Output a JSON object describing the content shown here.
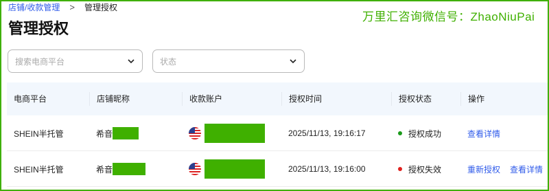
{
  "breadcrumb": {
    "parent": "店铺/收款管理",
    "separator": ">",
    "current": "管理授权"
  },
  "watermark": "万里汇咨询微信号：ZhaoNiuPai",
  "page_title": "管理授权",
  "filters": {
    "platform": {
      "placeholder": "搜索电商平台",
      "icon": "chevron-down-icon"
    },
    "status": {
      "placeholder": "状态",
      "icon": "chevron-down-icon"
    }
  },
  "table": {
    "headers": [
      "电商平台",
      "店铺昵称",
      "收款账户",
      "授权时间",
      "授权状态",
      "操作"
    ],
    "rows": [
      {
        "platform": "SHEIN半托管",
        "store_prefix": "希音",
        "account_flag": "us-flag-icon",
        "time": "2025/11/13, 19:16:17",
        "status": "授权成功",
        "status_color": "#1a9a1a",
        "actions": [
          "查看详情"
        ]
      },
      {
        "platform": "SHEIN半托管",
        "store_prefix": "希音",
        "account_flag": "us-flag-icon",
        "time": "2025/11/13, 19:16:00",
        "status": "授权失效",
        "status_color": "#e0201d",
        "actions": [
          "重新授权",
          "查看详情"
        ]
      }
    ]
  },
  "colors": {
    "accent": "#2f5bea",
    "redaction": "#3fb000",
    "header_bg": "#f2f7fd"
  }
}
